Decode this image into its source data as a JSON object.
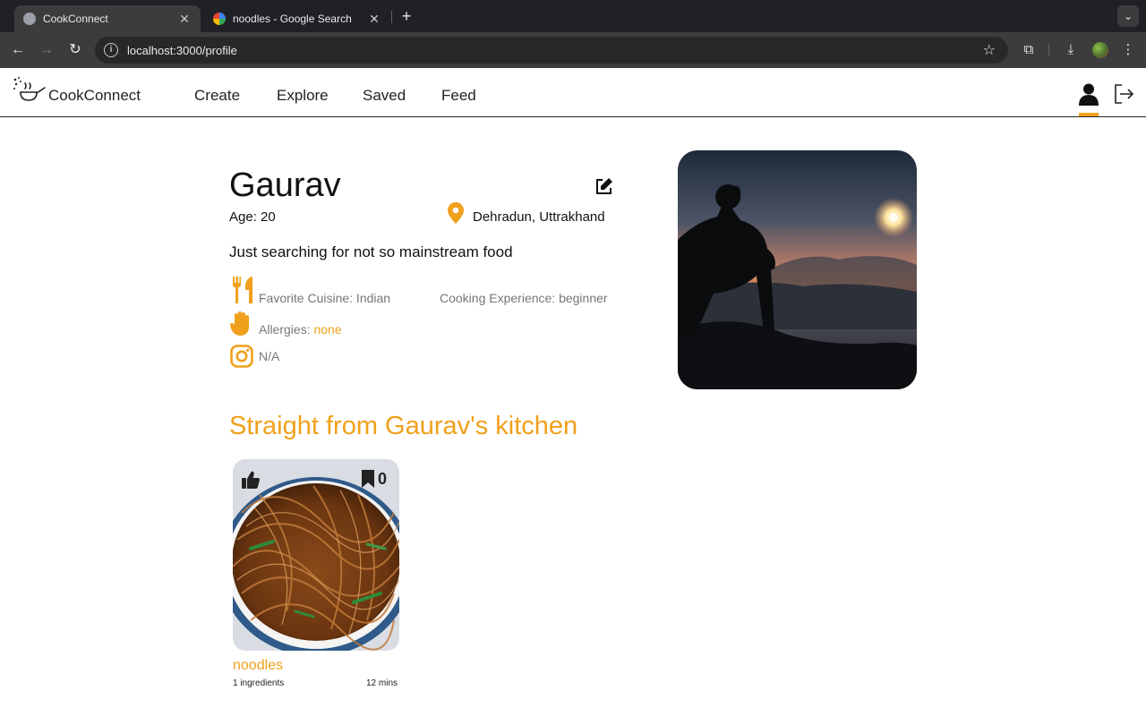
{
  "browser": {
    "tabs": [
      {
        "title": "CookConnect",
        "active": true,
        "icon": "globe-icon"
      },
      {
        "title": "noodles - Google Search",
        "active": false,
        "icon": "google-icon"
      }
    ],
    "url": "localhost:3000/profile"
  },
  "header": {
    "brand": "CookConnect",
    "nav": [
      "Create",
      "Explore",
      "Saved",
      "Feed"
    ],
    "accent": "#f0a01c"
  },
  "profile": {
    "name": "Gaurav",
    "age": "Age: 20",
    "location": "Dehradun, Uttrakhand",
    "bio": "Just searching for not so mainstream food",
    "cuisine": "Favorite Cuisine: Indian",
    "experience": "Cooking Experience: beginner",
    "allergies_label": "Allergies:",
    "allergies_value": "none",
    "instagram": "N/A"
  },
  "kitchen": {
    "title": "Straight from Gaurav's kitchen",
    "recipes": [
      {
        "name": "noodles",
        "ingredients": "1 ingredients",
        "time": "12 mins",
        "saves": "0"
      }
    ]
  }
}
